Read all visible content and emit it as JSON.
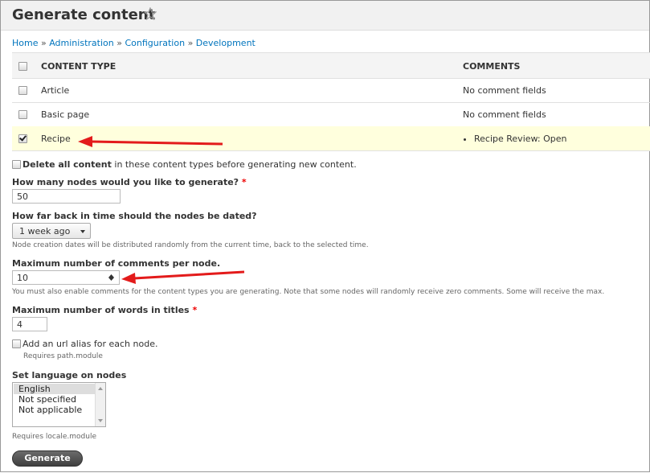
{
  "page": {
    "title": "Generate content"
  },
  "breadcrumb": [
    "Home",
    "Administration",
    "Configuration",
    "Development"
  ],
  "breadcrumb_sep": "»",
  "table": {
    "headers": {
      "type": "CONTENT TYPE",
      "comments": "COMMENTS"
    },
    "rows": [
      {
        "type": "Article",
        "comments": "No comment fields",
        "checked": false
      },
      {
        "type": "Basic page",
        "comments": "No comment fields",
        "checked": false
      },
      {
        "type": "Recipe",
        "comments": "Recipe Review: Open",
        "checked": true
      }
    ]
  },
  "delete_all": {
    "bold": "Delete all content",
    "rest": " in these content types before generating new content."
  },
  "nodes": {
    "label": "How many nodes would you like to generate?",
    "required": "*",
    "value": "50"
  },
  "dated": {
    "label": "How far back in time should the nodes be dated?",
    "value": "1 week ago",
    "description": "Node creation dates will be distributed randomly from the current time, back to the selected time."
  },
  "comments_max": {
    "label": "Maximum number of comments per node.",
    "value": "10",
    "description": "You must also enable comments for the content types you are generating. Note that some nodes will randomly receive zero comments. Some will receive the max."
  },
  "title_words": {
    "label": "Maximum number of words in titles",
    "required": "*",
    "value": "4"
  },
  "url_alias": {
    "label": "Add an url alias for each node.",
    "description": "Requires path.module"
  },
  "language": {
    "label": "Set language on nodes",
    "options": [
      "English",
      "Not specified",
      "Not applicable"
    ],
    "selected": "English",
    "description": "Requires locale.module"
  },
  "generate_button": "Generate",
  "colors": {
    "accent": "#e31b1b",
    "link": "#0074bd",
    "highlight": "#ffffdd"
  }
}
